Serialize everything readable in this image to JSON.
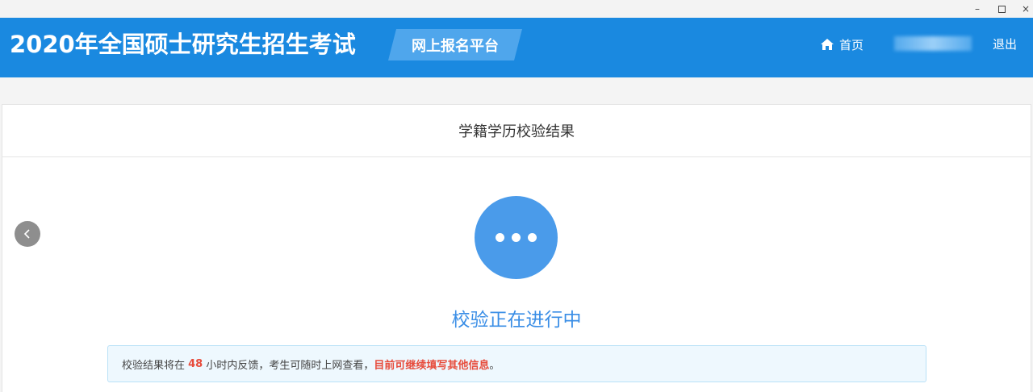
{
  "window": {
    "minimize_glyph": "–",
    "close_glyph": "×"
  },
  "header": {
    "title": "2020年全国硕士研究生招生考试",
    "platform_tag": "网上报名平台",
    "home_label": "首页",
    "home_icon": "home-icon",
    "logout_label": "退出",
    "colors": {
      "background": "#1a89e0",
      "tag_background": "#4fa6ec"
    }
  },
  "panel": {
    "title": "学籍学历校验结果",
    "back_icon": "chevron-left-icon",
    "status_icon": "ellipsis-icon",
    "status_text": "校验正在进行中",
    "notice": {
      "text_before": "校验结果将在 ",
      "hours": "48",
      "text_middle": " 小时内反馈，考生可随时上网查看，",
      "highlight": "目前可继续填写其他信息",
      "text_end": "。"
    },
    "colors": {
      "status_circle": "#4a9bea",
      "status_text": "#3a8ee6",
      "highlight": "#e74c3c",
      "notice_background": "#eef8fe"
    }
  }
}
